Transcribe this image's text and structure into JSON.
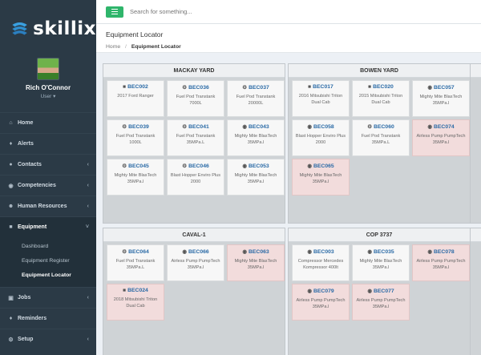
{
  "app": {
    "logo": "skillix"
  },
  "user": {
    "name": "Rich O'Connor",
    "role": "User ▾"
  },
  "nav": [
    {
      "label": "Home",
      "icon": "home-icon"
    },
    {
      "label": "Alerts",
      "icon": "bell-icon"
    },
    {
      "label": "Contacts",
      "icon": "user-icon",
      "chevron": "‹"
    },
    {
      "label": "Competencies",
      "icon": "globe-icon",
      "chevron": "‹"
    },
    {
      "label": "Human Resources",
      "icon": "users-icon",
      "chevron": "‹"
    },
    {
      "label": "Equipment",
      "icon": "truck-icon",
      "chevron": "˅"
    }
  ],
  "equipment_sub": [
    "Dashboard",
    "Equipment Register",
    "Equipment Locator"
  ],
  "nav_bottom": [
    {
      "label": "Jobs",
      "icon": "briefcase-icon",
      "chevron": "‹"
    },
    {
      "label": "Reminders",
      "icon": "bell-icon"
    },
    {
      "label": "Setup",
      "icon": "gear-icon",
      "chevron": "‹"
    }
  ],
  "search": {
    "placeholder": "Search for something..."
  },
  "page": {
    "title": "Equipment Locator",
    "breadcrumb_home": "Home",
    "breadcrumb_sep": "/",
    "breadcrumb_current": "Equipment Locator"
  },
  "yards": [
    {
      "name": "MACKAY YARD",
      "cards": [
        {
          "code": "BEC002",
          "type": "truck",
          "desc": "2017 Ford Ranger",
          "alert": false
        },
        {
          "code": "BEC036",
          "type": "gears",
          "desc": "Fuel Pod Transtank 7000L",
          "alert": false
        },
        {
          "code": "BEC037",
          "type": "gears",
          "desc": "Fuel Pod Transtank 20000L",
          "alert": false
        },
        {
          "code": "BEC039",
          "type": "gears",
          "desc": "Fuel Pod Transtank 1000L",
          "alert": false
        },
        {
          "code": "BEC041",
          "type": "gears",
          "desc": "Fuel Pod Transtank 35MPa.L",
          "alert": false
        },
        {
          "code": "BEC043",
          "type": "gauge",
          "desc": "Mighty Mite BlasTech 35MPa.l",
          "alert": false
        },
        {
          "code": "BEC045",
          "type": "gears",
          "desc": "Mighty Mite BlasTech 35MPa.l",
          "alert": false
        },
        {
          "code": "BEC046",
          "type": "gears",
          "desc": "Blast Hopper Enviro Plus 2000",
          "alert": false
        },
        {
          "code": "BEC053",
          "type": "gauge",
          "desc": "Mighty Mite BlasTech 35MPa.l",
          "alert": false
        }
      ]
    },
    {
      "name": "BOWEN YARD",
      "cards": [
        {
          "code": "BEC017",
          "type": "truck",
          "desc": "2016 Mitsubishi Triton Dual Cab",
          "alert": false
        },
        {
          "code": "BEC020",
          "type": "truck",
          "desc": "2015 Mitsubishi Triton Dual Cab",
          "alert": false
        },
        {
          "code": "BEC057",
          "type": "gauge",
          "desc": "Mighty Mite BlasTech 35MPa.l",
          "alert": false
        },
        {
          "code": "BEC058",
          "type": "gauge",
          "desc": "Blast Hopper Enviro Plus 2000",
          "alert": false
        },
        {
          "code": "BEC060",
          "type": "gears",
          "desc": "Fuel Pod Transtank 35MPa.L",
          "alert": false
        },
        {
          "code": "BEC074",
          "type": "gauge",
          "desc": "Airless Pump PumpTech 35MPa.l",
          "alert": true
        },
        {
          "code": "BEC065",
          "type": "gauge",
          "desc": "Mighty Mite BlasTech 35MPa.l",
          "alert": true
        }
      ]
    },
    {
      "name": "CAVAL-1",
      "cards": [
        {
          "code": "BEC064",
          "type": "gears",
          "desc": "Fuel Pod Transtank 35MPa.L",
          "alert": false
        },
        {
          "code": "BEC066",
          "type": "gauge",
          "desc": "Airless Pump PumpTech 35MPa.l",
          "alert": false
        },
        {
          "code": "BEC063",
          "type": "gauge",
          "desc": "Mighty Mite BlasTech 35MPa.l",
          "alert": true
        },
        {
          "code": "BEC024",
          "type": "truck",
          "desc": "2018 Mitsubishi Triton Dual Cab",
          "alert": true
        }
      ]
    },
    {
      "name": "COP 3737",
      "cards": [
        {
          "code": "BEC003",
          "type": "gauge",
          "desc": "Compressor Mercedes Kompressor 400lt",
          "alert": false
        },
        {
          "code": "BEC035",
          "type": "gauge",
          "desc": "Mighty Mite BlasTech 35MPa.l",
          "alert": false
        },
        {
          "code": "BEC078",
          "type": "gauge",
          "desc": "Airless Pump PumpTech 35MPa.l",
          "alert": true
        },
        {
          "code": "BEC079",
          "type": "gauge",
          "desc": "Airless Pump PumpTech 35MPa.l",
          "alert": true
        },
        {
          "code": "BEC077",
          "type": "gauge",
          "desc": "Airless Pump PumpTech 35MPa.l",
          "alert": true
        }
      ]
    }
  ],
  "colors": {
    "sidebar": "#2b3a46",
    "accent_green": "#2fb56b",
    "link_blue": "#2a6aa6",
    "alert_card": "#f2dcdc"
  }
}
